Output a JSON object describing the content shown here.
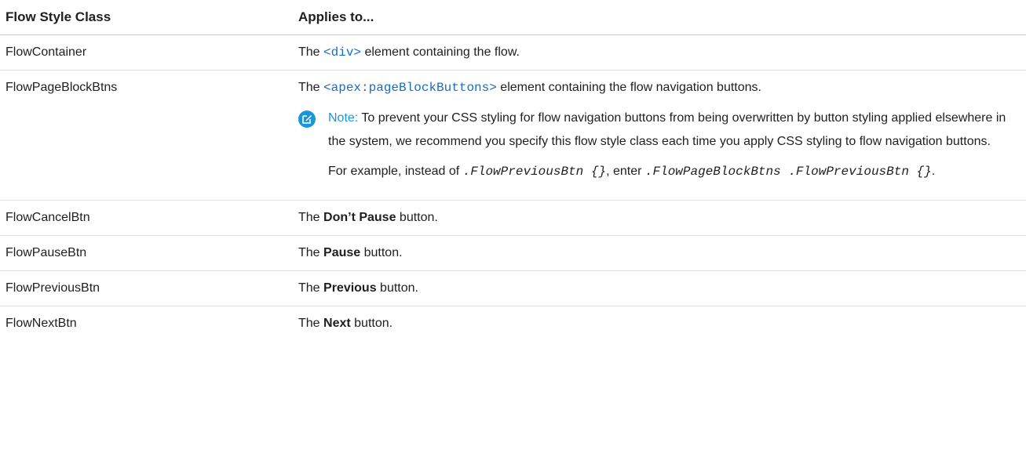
{
  "table": {
    "headers": [
      "Flow Style Class",
      "Applies to..."
    ],
    "rows": [
      {
        "class_name": "FlowContainer",
        "prefix": "The ",
        "code": "<div>",
        "suffix": " element containing the flow."
      },
      {
        "class_name": "FlowPageBlockBtns",
        "prefix": "The ",
        "code": "<apex:pageBlockButtons>",
        "suffix": " element containing the flow navigation buttons.",
        "note_label": "Note:",
        "note_text": " To prevent your CSS styling for flow navigation buttons from being overwritten by button styling applied elsewhere in the system, we recommend you specify this flow style class each time you apply CSS styling to flow navigation buttons.",
        "example_prefix": "For example, instead of ",
        "example_code1": ".FlowPreviousBtn {}",
        "example_mid": ", enter ",
        "example_code2": ".FlowPageBlockBtns .FlowPreviousBtn {}",
        "example_end": "."
      },
      {
        "class_name": "FlowCancelBtn",
        "prefix": "The ",
        "bold": "Don’t Pause",
        "suffix": " button."
      },
      {
        "class_name": "FlowPauseBtn",
        "prefix": "The ",
        "bold": "Pause",
        "suffix": " button."
      },
      {
        "class_name": "FlowPreviousBtn",
        "prefix": "The ",
        "bold": "Previous",
        "suffix": " button."
      },
      {
        "class_name": "FlowNextBtn",
        "prefix": "The ",
        "bold": "Next",
        "suffix": " button."
      }
    ]
  },
  "colors": {
    "code": "#1b6dc1",
    "note_accent": "#1b96d9"
  },
  "icons": {
    "note": "edit-note-icon"
  }
}
